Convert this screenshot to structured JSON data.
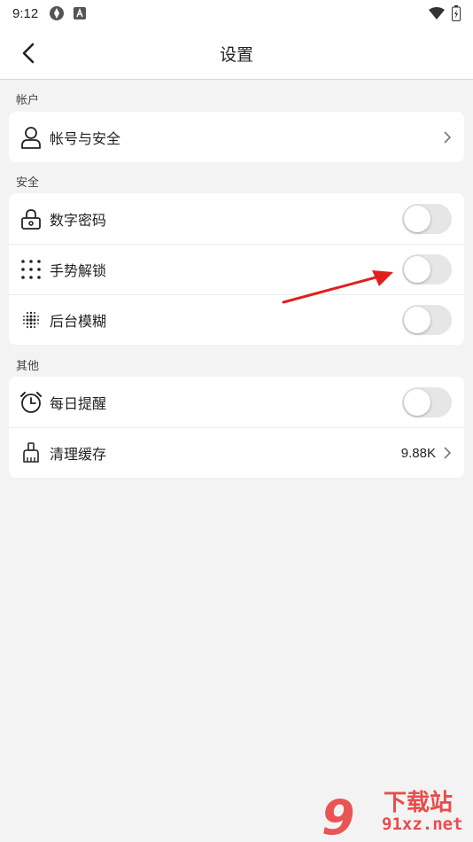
{
  "status_bar": {
    "time": "9:12"
  },
  "header": {
    "title": "设置"
  },
  "sections": {
    "account": {
      "label": "帐户",
      "items": [
        {
          "label": "帐号与安全",
          "icon": "user-icon"
        }
      ]
    },
    "security": {
      "label": "安全",
      "items": [
        {
          "label": "数字密码",
          "icon": "lock-icon",
          "toggle": false
        },
        {
          "label": "手势解锁",
          "icon": "dot-grid-icon",
          "toggle": false
        },
        {
          "label": "后台模糊",
          "icon": "blur-icon",
          "toggle": false
        }
      ]
    },
    "other": {
      "label": "其他",
      "items": [
        {
          "label": "每日提醒",
          "icon": "alarm-clock-icon",
          "toggle": false
        },
        {
          "label": "清理缓存",
          "icon": "broom-icon",
          "value": "9.88K"
        }
      ]
    }
  },
  "annotation": {
    "arrow_color": "#e02020"
  },
  "watermark": {
    "number": "9",
    "text": "下载站",
    "site": "91xz.net"
  },
  "colors": {
    "toggle_off": "#e6e6e6",
    "background": "#f3f3f3"
  }
}
